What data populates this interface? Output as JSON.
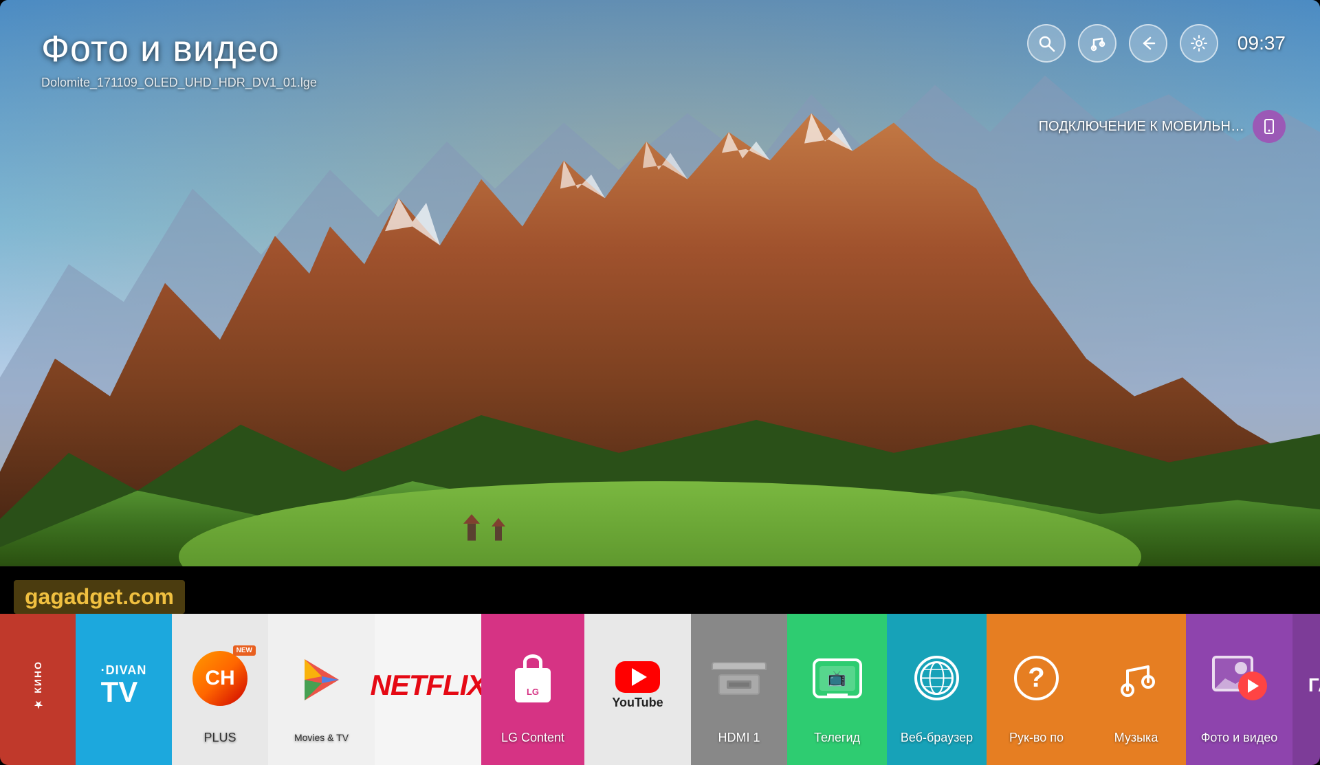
{
  "screen": {
    "title": "Фото и видео",
    "filename": "Dolomite_171109_OLED_UHD_HDR_DV1_01.lge",
    "time": "09:37",
    "mobile_connect_label": "ПОДКЛЮЧЕНИЕ К МОБИЛЬН…",
    "watermark": "gagadget.com"
  },
  "toolbar": {
    "search_label": "🔍",
    "music_label": "♪",
    "back_label": "↩",
    "settings_label": "⚙"
  },
  "apps": [
    {
      "id": "kino",
      "label": "КИНО",
      "bg": "#c0392b"
    },
    {
      "id": "divan",
      "label": "DIVAN TV",
      "bg": "#1ca8dd"
    },
    {
      "id": "ch-plus",
      "label": "CH+",
      "bg": "#e8e8e8"
    },
    {
      "id": "google-play",
      "label": "Google Play Movies & TV",
      "bg": "#f0f0f0"
    },
    {
      "id": "netflix",
      "label": "NETFLIX",
      "bg": "#f5f5f5"
    },
    {
      "id": "lg-content",
      "label": "LG Content",
      "bg": "#d63384"
    },
    {
      "id": "youtube",
      "label": "YouTube",
      "bg": "#f0f0f0"
    },
    {
      "id": "hdmi",
      "label": "HDMI 1",
      "bg": "#888888"
    },
    {
      "id": "tvguide",
      "label": "Телегид",
      "bg": "#2ecc71"
    },
    {
      "id": "browser",
      "label": "Веб-браузер",
      "bg": "#17a2b8"
    },
    {
      "id": "manual",
      "label": "Рук-во по",
      "bg": "#e67e22"
    },
    {
      "id": "music",
      "label": "Музыка",
      "bg": "#e67e22"
    },
    {
      "id": "photo-video",
      "label": "Фото и видео",
      "bg": "#8e44ad"
    },
    {
      "id": "ga",
      "label": "ГА",
      "bg": "#7D3C98"
    }
  ]
}
